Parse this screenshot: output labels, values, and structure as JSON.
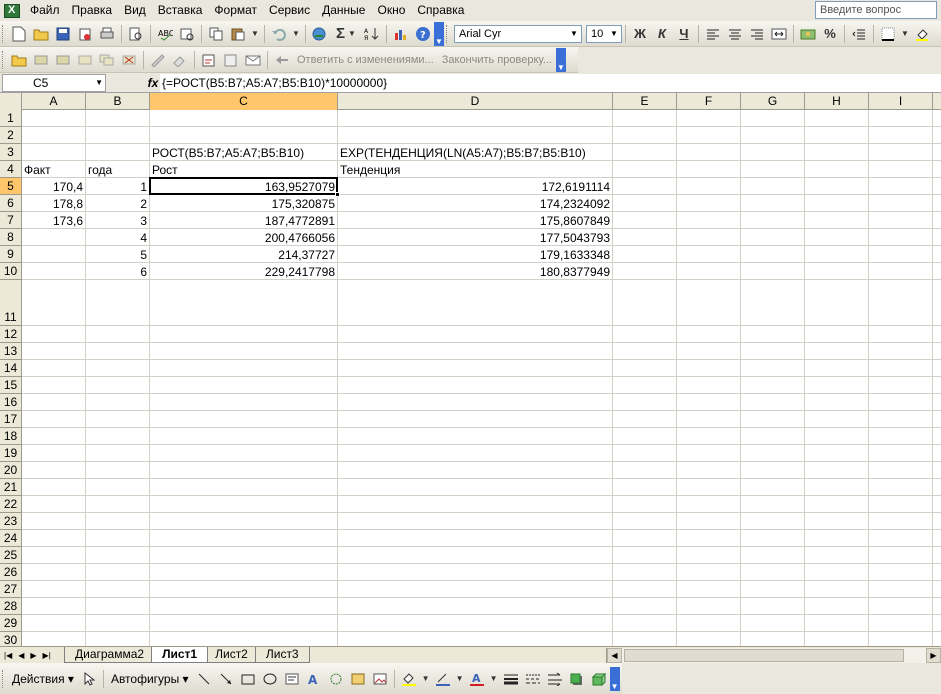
{
  "menu": {
    "items": [
      "Файл",
      "Правка",
      "Вид",
      "Вставка",
      "Формат",
      "Сервис",
      "Данные",
      "Окно",
      "Справка"
    ],
    "question_placeholder": "Введите вопрос"
  },
  "toolbar1": {
    "font_name": "Arial Cyr",
    "font_size": "10",
    "bold": "Ж",
    "italic": "К",
    "underline": "Ч",
    "sum": "Σ",
    "percent": "%"
  },
  "toolbar2": {
    "reply_with_changes": "Ответить с изменениями...",
    "end_review": "Закончить проверку..."
  },
  "formula_bar": {
    "name_box": "C5",
    "fx": "fx",
    "formula": "{=РОСТ(B5:B7;A5:A7;B5:B10)*10000000}"
  },
  "columns": [
    "A",
    "B",
    "C",
    "D",
    "E",
    "F",
    "G",
    "H",
    "I"
  ],
  "rows": [
    "1",
    "2",
    "3",
    "4",
    "5",
    "6",
    "7",
    "8",
    "9",
    "10",
    "11",
    "12",
    "13",
    "14",
    "15",
    "16",
    "17",
    "18",
    "19",
    "20",
    "21",
    "22",
    "23",
    "24",
    "25",
    "26",
    "27",
    "28",
    "29",
    "30"
  ],
  "active_cell": {
    "col": "C",
    "row": "5"
  },
  "cells": {
    "C3": "РОСТ(B5:B7;A5:A7;B5:B10)",
    "D3": "EXP(ТЕНДЕНЦИЯ(LN(A5:A7);B5:B7;B5:B10)",
    "A4": "Факт",
    "B4": "года",
    "C4": "Рост",
    "D4": "Тенденция",
    "A5": "170,4",
    "B5": "1",
    "C5": "163,9527079",
    "D5": "172,6191114",
    "A6": "178,8",
    "B6": "2",
    "C6": "175,320875",
    "D6": "174,2324092",
    "A7": "173,6",
    "B7": "3",
    "C7": "187,4772891",
    "D7": "175,8607849",
    "B8": "4",
    "C8": "200,4766056",
    "D8": "177,5043793",
    "B9": "5",
    "C9": "214,37727",
    "D9": "179,1633348",
    "B10": "6",
    "C10": "229,2417798",
    "D10": "180,8377949"
  },
  "sheet_tabs": [
    "Диаграмма2",
    "Лист1",
    "Лист2",
    "Лист3"
  ],
  "active_sheet": "Лист1",
  "drawing_toolbar": {
    "actions": "Действия",
    "autoshapes": "Автофигуры"
  }
}
